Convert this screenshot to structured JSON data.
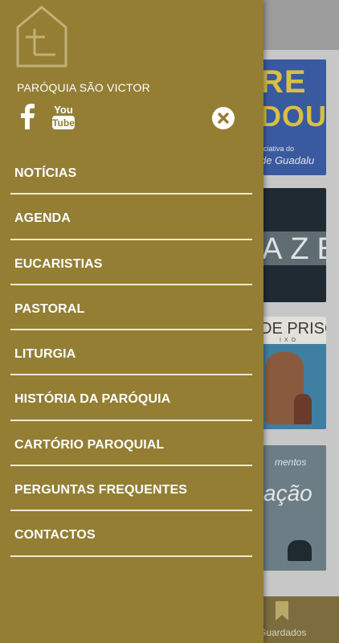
{
  "drawer": {
    "parish_name": "PARÓQUIA SÃO VICTOR",
    "social": [
      {
        "name": "facebook-icon"
      },
      {
        "name": "youtube-icon",
        "label_line1": "You",
        "label_line2": "Tube"
      }
    ],
    "close_icon": "close-icon",
    "menu": [
      {
        "label": "NOTÍCIAS"
      },
      {
        "label": "AGENDA"
      },
      {
        "label": "EUCARISTIAS"
      },
      {
        "label": "PASTORAL"
      },
      {
        "label": "LITURGIA"
      },
      {
        "label": "HISTÓRIA DA PARÓQUIA"
      },
      {
        "label": "CARTÓRIO PAROQUIAL"
      },
      {
        "label": "PERGUNTAS FREQUENTES"
      },
      {
        "label": "CONTACTOS"
      }
    ]
  },
  "background": {
    "cards": [
      {
        "line1": "RE",
        "line2": "DOU",
        "line3": "ciativa do",
        "line4": "de Guadalu"
      },
      {
        "text": "AZE"
      },
      {
        "text": "DE PRISC",
        "sub": "IXO"
      },
      {
        "text1": "mentos",
        "text2": "ação"
      }
    ],
    "bottom_nav_label": "Guardados"
  },
  "colors": {
    "drawer_bg": "#937e34",
    "divider": "#f1ead0",
    "text": "#ffffff"
  }
}
